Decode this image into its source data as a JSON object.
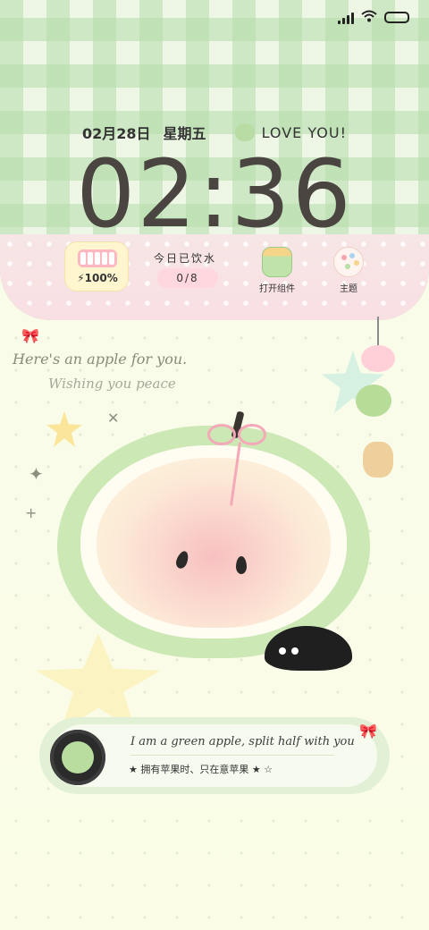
{
  "status": {
    "icons": [
      "signal-icon",
      "wifi-icon",
      "battery-icon"
    ]
  },
  "date": {
    "day": "02月28日",
    "weekday": "星期五",
    "love": "LOVE YOU!"
  },
  "clock": {
    "time": "02:36"
  },
  "widgets": {
    "battery": {
      "label": "100%",
      "level": 1.0
    },
    "water": {
      "title": "今日已饮水",
      "value": "0/8"
    },
    "open_widget": {
      "label": "打开组件"
    },
    "theme": {
      "label": "主题"
    }
  },
  "handwriting": {
    "line1": "Here's an apple for you.",
    "line2": "Wishing you peace"
  },
  "music": {
    "title": "I am a green apple, split half with you",
    "lyric": "★ 拥有苹果时、只在意苹果 ★ ☆"
  },
  "colors": {
    "accent": "#cbe8b5",
    "pink": "#f5a8b8",
    "text": "#4a4540"
  }
}
